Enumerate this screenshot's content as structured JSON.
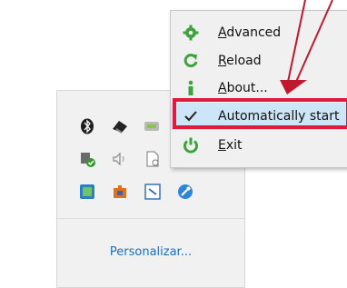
{
  "menu": {
    "items": [
      {
        "label": "Advanced",
        "icon": "gear-icon"
      },
      {
        "label": "Reload",
        "icon": "reload-icon"
      },
      {
        "label": "About...",
        "icon": "info-icon"
      },
      {
        "label": "Automatically start",
        "icon": "checkmark-icon",
        "checked": true
      },
      {
        "label": "Exit",
        "icon": "power-icon"
      }
    ]
  },
  "tray": {
    "personalize_label": "Personalizar...",
    "icons": [
      "bluetooth-icon",
      "network-icon",
      "sync-icon",
      "security-icon",
      "speaker-icon",
      "document-icon",
      "app-icon",
      "puzzle-icon",
      "window-icon",
      "wrench-icon"
    ]
  },
  "colors": {
    "highlight_box": "#e01a3c",
    "arrow": "#c0182e",
    "menu_green": "#3aa33a",
    "link": "#1d6fba"
  }
}
